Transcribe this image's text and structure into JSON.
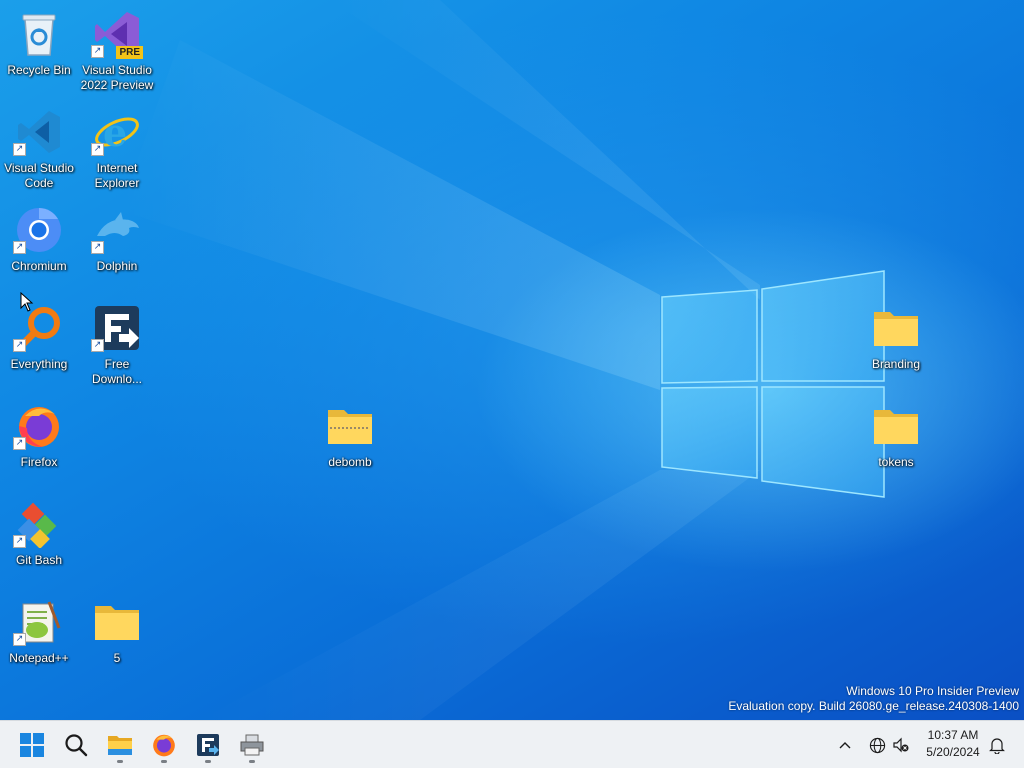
{
  "desktop": {
    "icons": [
      {
        "label": "Recycle Bin",
        "icon": "recycle-bin-icon"
      },
      {
        "label": "Visual Studio 2022 Preview",
        "icon": "visual-studio-icon",
        "badge": "PRE"
      },
      {
        "label": "Visual Studio Code",
        "icon": "vscode-icon"
      },
      {
        "label": "Internet Explorer",
        "icon": "internet-explorer-icon"
      },
      {
        "label": "Chromium",
        "icon": "chromium-icon"
      },
      {
        "label": "Dolphin",
        "icon": "dolphin-icon"
      },
      {
        "label": "Everything",
        "icon": "everything-search-icon"
      },
      {
        "label": "Free Downlo...",
        "icon": "free-download-manager-icon"
      },
      {
        "label": "Firefox",
        "icon": "firefox-icon"
      },
      {
        "label": "Git Bash",
        "icon": "git-bash-icon"
      },
      {
        "label": "Notepad++",
        "icon": "notepadpp-icon"
      },
      {
        "label": "5",
        "icon": "folder-icon"
      },
      {
        "label": "debomb",
        "icon": "zip-folder-icon"
      },
      {
        "label": "Branding",
        "icon": "folder-icon"
      },
      {
        "label": "tokens",
        "icon": "folder-icon"
      }
    ],
    "watermark": {
      "line1": "Windows 10 Pro Insider Preview",
      "line2": "Evaluation copy. Build 26080.ge_release.240308-1400"
    }
  },
  "taskbar": {
    "items": [
      {
        "name": "start-button",
        "icon": "windows-logo-icon"
      },
      {
        "name": "search-button",
        "icon": "search-icon"
      },
      {
        "name": "file-explorer-button",
        "icon": "file-explorer-icon"
      },
      {
        "name": "firefox-taskbar-button",
        "icon": "firefox-icon"
      },
      {
        "name": "free-download-manager-taskbar-button",
        "icon": "free-download-manager-icon"
      },
      {
        "name": "app-taskbar-button",
        "icon": "printer-app-icon"
      }
    ],
    "tray": {
      "chevron": "^",
      "time": "10:37 AM",
      "date": "5/20/2024"
    }
  },
  "colors": {
    "accent": "#0078d4",
    "desktop_blue": "#0f86e3",
    "taskbar_bg": "#eef1f4"
  }
}
